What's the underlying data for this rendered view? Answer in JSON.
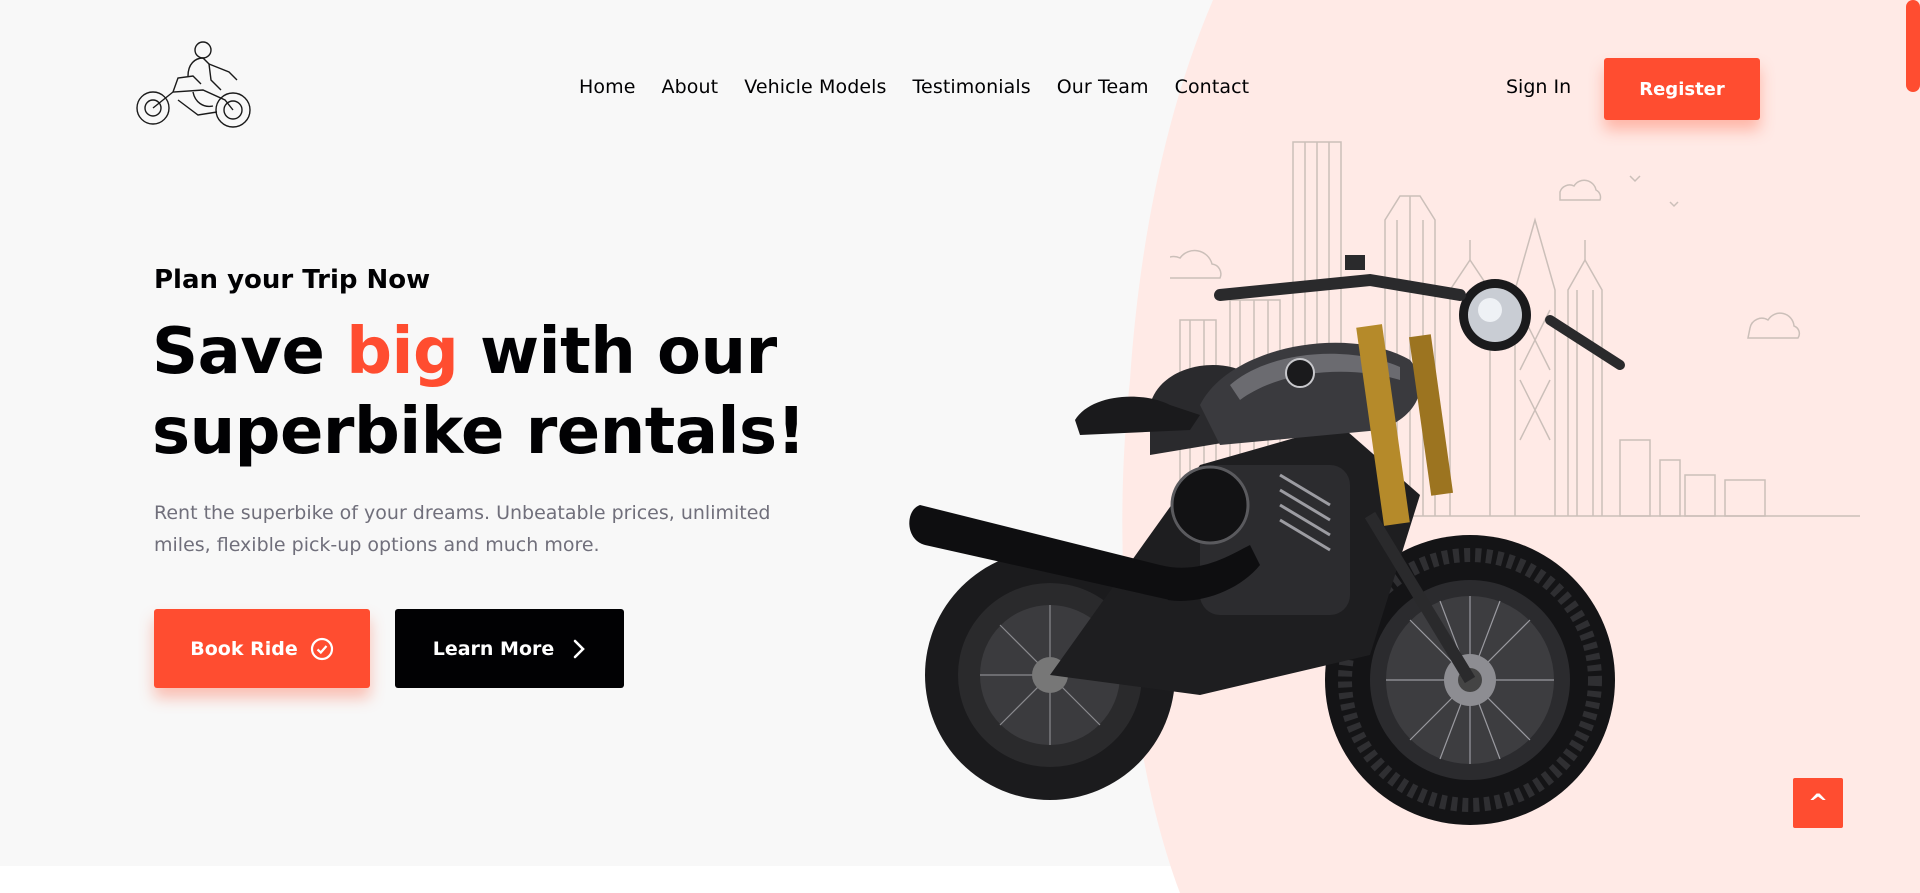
{
  "header": {
    "logo_icon": "motorcycle-rider-icon",
    "nav": [
      {
        "label": "Home"
      },
      {
        "label": "About"
      },
      {
        "label": "Vehicle Models"
      },
      {
        "label": "Testimonials"
      },
      {
        "label": "Our Team"
      },
      {
        "label": "Contact"
      }
    ],
    "sign_in": "Sign In",
    "register": "Register"
  },
  "hero": {
    "subtitle": "Plan your Trip Now",
    "title_part1": "Save ",
    "title_accent": "big",
    "title_part2": " with our superbike rentals!",
    "description": "Rent the superbike of your dreams. Unbeatable prices, unlimited miles, flexible pick-up options and much more.",
    "book_button": "Book Ride",
    "book_icon": "check-circle-icon",
    "learn_button": "Learn More",
    "learn_icon": "chevron-right-icon"
  },
  "scroll_up": {
    "label": "^"
  },
  "colors": {
    "accent": "#ff4d30",
    "dark": "#010103",
    "text_gray": "#706f7b",
    "hero_bg": "#f8f8f8",
    "blob": "#ffeae6"
  }
}
